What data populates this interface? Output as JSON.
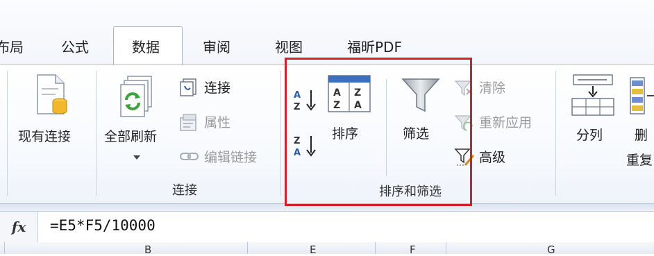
{
  "tabs": [
    {
      "label": "布局",
      "active": false
    },
    {
      "label": "公式",
      "active": false
    },
    {
      "label": "数据",
      "active": true
    },
    {
      "label": "审阅",
      "active": false
    },
    {
      "label": "视图",
      "active": false
    },
    {
      "label": "福昕PDF",
      "active": false
    }
  ],
  "ribbon": {
    "existing_connections": "现有连接",
    "refresh_all": "全部刷新",
    "connections_group": {
      "connections": "连接",
      "properties": "属性",
      "edit_links": "编辑链接",
      "group_label": "连接"
    },
    "sort_filter_group": {
      "sort_az_glyph": "AZ",
      "sort_za_glyph": "ZA",
      "sort": "排序",
      "filter": "筛选",
      "clear": "清除",
      "reapply": "重新应用",
      "advanced": "高级",
      "group_label": "排序和筛选"
    },
    "text_to_columns": "分列",
    "remove_dup_top": "删",
    "remove_dup_bottom": "重复"
  },
  "formula_bar": {
    "fx_label": "fx",
    "formula": "=E5*F5/10000"
  },
  "column_headers": [
    "B",
    "E",
    "F",
    "G"
  ],
  "colors": {
    "highlight": "#d21f2a",
    "tab_border": "#a9b6c8",
    "ribbon_bg": "#f6f9fd"
  }
}
